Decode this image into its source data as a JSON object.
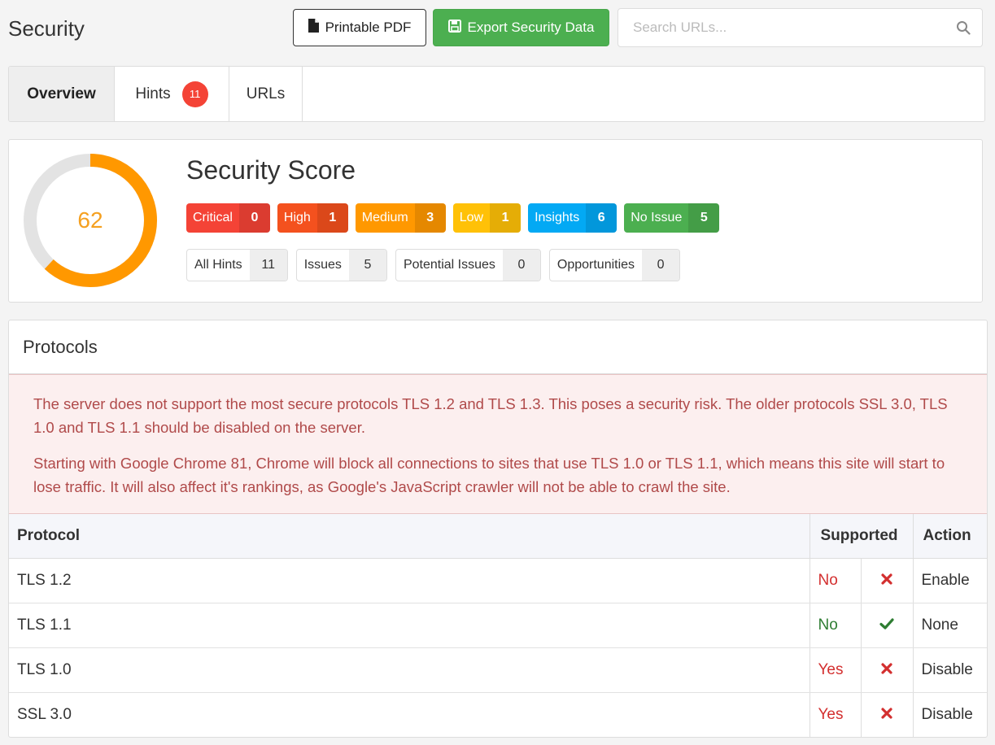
{
  "page_title": "Security",
  "toolbar": {
    "pdf_label": "Printable PDF",
    "export_label": "Export Security Data",
    "search_placeholder": "Search URLs..."
  },
  "tabs": [
    {
      "label": "Overview",
      "active": true
    },
    {
      "label": "Hints",
      "badge": "11"
    },
    {
      "label": "URLs"
    }
  ],
  "score": {
    "value": "62",
    "fraction": 0.62,
    "title": "Security Score",
    "ring_color": "#ff9800",
    "track_color": "#e3e3e3"
  },
  "severity": [
    {
      "label": "Critical",
      "count": "0",
      "color": "#f44336"
    },
    {
      "label": "High",
      "count": "1",
      "color": "#f4511e"
    },
    {
      "label": "Medium",
      "count": "3",
      "color": "#ff9800"
    },
    {
      "label": "Low",
      "count": "1",
      "color": "#ffc107"
    },
    {
      "label": "Insights",
      "count": "6",
      "color": "#03a9f4"
    },
    {
      "label": "No Issue",
      "count": "5",
      "color": "#4caf50"
    }
  ],
  "hint_filters": [
    {
      "label": "All Hints",
      "count": "11"
    },
    {
      "label": "Issues",
      "count": "5"
    },
    {
      "label": "Potential Issues",
      "count": "0"
    },
    {
      "label": "Opportunities",
      "count": "0"
    }
  ],
  "protocols": {
    "title": "Protocols",
    "alert": [
      "The server does not support the most secure protocols TLS 1.2 and TLS 1.3. This poses a security risk. The older protocols SSL 3.0, TLS 1.0 and TLS 1.1 should be disabled on the server.",
      "Starting with Google Chrome 81, Chrome will block all connections to sites that use TLS 1.0 or TLS 1.1, which means this site will start to lose traffic. It will also affect it's rankings, as Google's JavaScript crawler will not be able to crawl the site."
    ],
    "columns": {
      "protocol": "Protocol",
      "supported": "Supported",
      "action": "Action"
    },
    "rows": [
      {
        "protocol": "TLS 1.2",
        "supported": "No",
        "status": "bad",
        "action": "Enable"
      },
      {
        "protocol": "TLS 1.1",
        "supported": "No",
        "status": "good",
        "action": "None"
      },
      {
        "protocol": "TLS 1.0",
        "supported": "Yes",
        "status": "bad",
        "action": "Disable"
      },
      {
        "protocol": "SSL 3.0",
        "supported": "Yes",
        "status": "bad",
        "action": "Disable"
      }
    ]
  }
}
